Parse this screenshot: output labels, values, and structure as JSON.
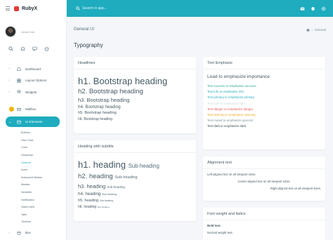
{
  "app": {
    "brand": "RubyX",
    "user_name": "Johan Doe"
  },
  "header": {
    "search_placeholder": "Search in app..."
  },
  "page": {
    "title": "General UI",
    "breadcrumb_current": "General",
    "section_title": "Typography"
  },
  "nav": [
    {
      "label": "Dashboard",
      "icon": "home-icon"
    },
    {
      "label": "Layout Options",
      "icon": "grid-icon"
    },
    {
      "label": "Widgets",
      "icon": "layers-icon"
    },
    {
      "label": "Mailbox",
      "icon": "mail-icon"
    },
    {
      "label": "UI Elements",
      "icon": "grid-icon"
    }
  ],
  "subnav": [
    "Buttons",
    "User Card",
    "Color",
    "Dropdown",
    "General",
    "Icons",
    "Advanced Medias",
    "Modals",
    "Nestable",
    "Notification",
    "Sweet Alert",
    "Tabs",
    "Timeline"
  ],
  "subnav_current": "General",
  "nav_more": {
    "label": "Box"
  },
  "cards": {
    "headlines": {
      "title": "Headlines",
      "h1": "h1. Bootstrap heading",
      "h2": "h2. Bootstrap heading",
      "h3": "h3. Bootstrap heading",
      "h4": "h4. Bootstrap heading",
      "h5": "h5. Bootstrap heading",
      "h6": "h6. Bootstrap heading"
    },
    "subtitle": {
      "title": "Heading with subtitle",
      "rows": [
        {
          "main": "h1. heading",
          "sub": "Sub-heading"
        },
        {
          "main": "h2. heading",
          "sub": "Sub-heading"
        },
        {
          "main": "h3. heading",
          "sub": "Sub-heading"
        },
        {
          "main": "h4. heading",
          "sub": "Sub-heading"
        },
        {
          "main": "h5. heading",
          "sub": "Sub-heading"
        },
        {
          "main": "h6. heading",
          "sub": "Sub-heading"
        }
      ]
    },
    "emphasis": {
      "title": "Text Emphasis",
      "lead": "Lead to emphasize importance",
      "lines": [
        {
          "text": "Text success to emphasize success",
          "color": "#26a69a"
        },
        {
          "text": "Text info to emphasize info",
          "color": "#26a5c4"
        },
        {
          "text": "Text primary to emphasize primary",
          "color": "#1eacbe"
        },
        {
          "text": "Text light to emphasize light",
          "color": "#cfd8dc"
        },
        {
          "text": "Text danger to emphasize danger",
          "color": "#ef5350"
        },
        {
          "text": "Text warning to emphasize warning",
          "color": "#f5a623"
        },
        {
          "text": "Text muted to emphasize general",
          "color": "#78909c"
        },
        {
          "text": "Text dark to emphasize dark",
          "color": "#37474f"
        }
      ]
    },
    "alignment": {
      "title": "Alignment text",
      "left": "Left aligned text on all viewport sizes.",
      "center": "Center aligned text on all viewport sizes.",
      "right": "Right aligned text on all viewport sizes."
    },
    "weight": {
      "title": "Font weight and italics",
      "bold": "Bold text.",
      "normal": "Normal weight text."
    }
  }
}
